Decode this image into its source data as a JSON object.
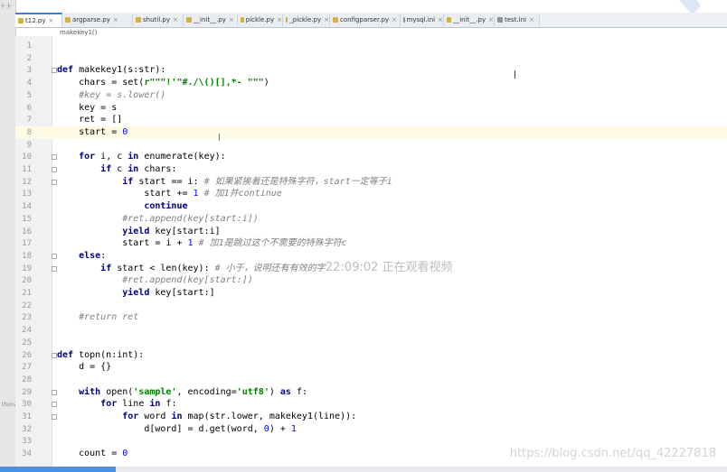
{
  "tabs": [
    {
      "label": "t12.py",
      "active": true,
      "icon": "python-file-icon"
    },
    {
      "label": "argparse.py",
      "icon": "python-file-icon"
    },
    {
      "label": "shutil.py",
      "icon": "python-file-icon"
    },
    {
      "label": "__init__.py",
      "icon": "python-file-icon"
    },
    {
      "label": "pickle.py",
      "icon": "python-file-icon"
    },
    {
      "label": "_pickle.py",
      "icon": "python-file-icon"
    },
    {
      "label": "configparser.py",
      "icon": "python-file-icon"
    },
    {
      "label": "mysql.ini",
      "icon": "ini-file-icon"
    },
    {
      "label": "__init__.py",
      "icon": "python-file-icon"
    },
    {
      "label": "test.ini",
      "icon": "ini-file-icon"
    }
  ],
  "breadcrumb": "makekey1()",
  "left_strip_top": "⊦ ⊦",
  "left_strip_label": "thonZ",
  "lines": [
    {
      "n": "1",
      "t": ""
    },
    {
      "n": "2",
      "t": ""
    },
    {
      "n": "3",
      "t": "def makekey1(s:str):"
    },
    {
      "n": "4",
      "t": "    chars = set(r\"\"\"!'\"#./\\()[],*- \"\"\")"
    },
    {
      "n": "5",
      "t": "    #key = s.lower()"
    },
    {
      "n": "6",
      "t": "    key = s"
    },
    {
      "n": "7",
      "t": "    ret = []"
    },
    {
      "n": "8",
      "t": "    start = 0"
    },
    {
      "n": "9",
      "t": ""
    },
    {
      "n": "10",
      "t": "    for i, c in enumerate(key):"
    },
    {
      "n": "11",
      "t": "        if c in chars:"
    },
    {
      "n": "12",
      "t": "            if start == i: # 如果紧挨着还是特殊字符，start一定等于i"
    },
    {
      "n": "13",
      "t": "                start += 1 # 加1并continue"
    },
    {
      "n": "14",
      "t": "                continue"
    },
    {
      "n": "15",
      "t": "            #ret.append(key[start:i])"
    },
    {
      "n": "16",
      "t": "            yield key[start:i]"
    },
    {
      "n": "17",
      "t": "            start = i + 1 # 加1是跳过这个不需要的特殊字符c"
    },
    {
      "n": "18",
      "t": "    else:"
    },
    {
      "n": "19",
      "t": "        if start < len(key): # 小于，说明还有有效的字"
    },
    {
      "n": "20",
      "t": "            #ret.append(key[start:])"
    },
    {
      "n": "21",
      "t": "            yield key[start:]"
    },
    {
      "n": "22",
      "t": ""
    },
    {
      "n": "23",
      "t": "    #return ret"
    },
    {
      "n": "24",
      "t": ""
    },
    {
      "n": "25",
      "t": ""
    },
    {
      "n": "26",
      "t": "def topn(n:int):"
    },
    {
      "n": "27",
      "t": "    d = {}"
    },
    {
      "n": "28",
      "t": ""
    },
    {
      "n": "29",
      "t": "    with open('sample', encoding='utf8') as f:"
    },
    {
      "n": "30",
      "t": "        for line in f:"
    },
    {
      "n": "31",
      "t": "            for word in map(str.lower, makekey1(line)):"
    },
    {
      "n": "32",
      "t": "                d[word] = d.get(word, 0) + 1"
    },
    {
      "n": "33",
      "t": ""
    },
    {
      "n": "34",
      "t": "    count = 0"
    }
  ],
  "current_line": 8,
  "overlay_text": "22:09:02 正在观看视频",
  "watermark": "https://blog.csdn.net/qq_42227818",
  "colors": {
    "keyword": "#000080",
    "string": "#008000",
    "number": "#0000ff",
    "comment": "#808080",
    "current_line": "#fffae3",
    "tab_accent": "#3a7fd5"
  }
}
